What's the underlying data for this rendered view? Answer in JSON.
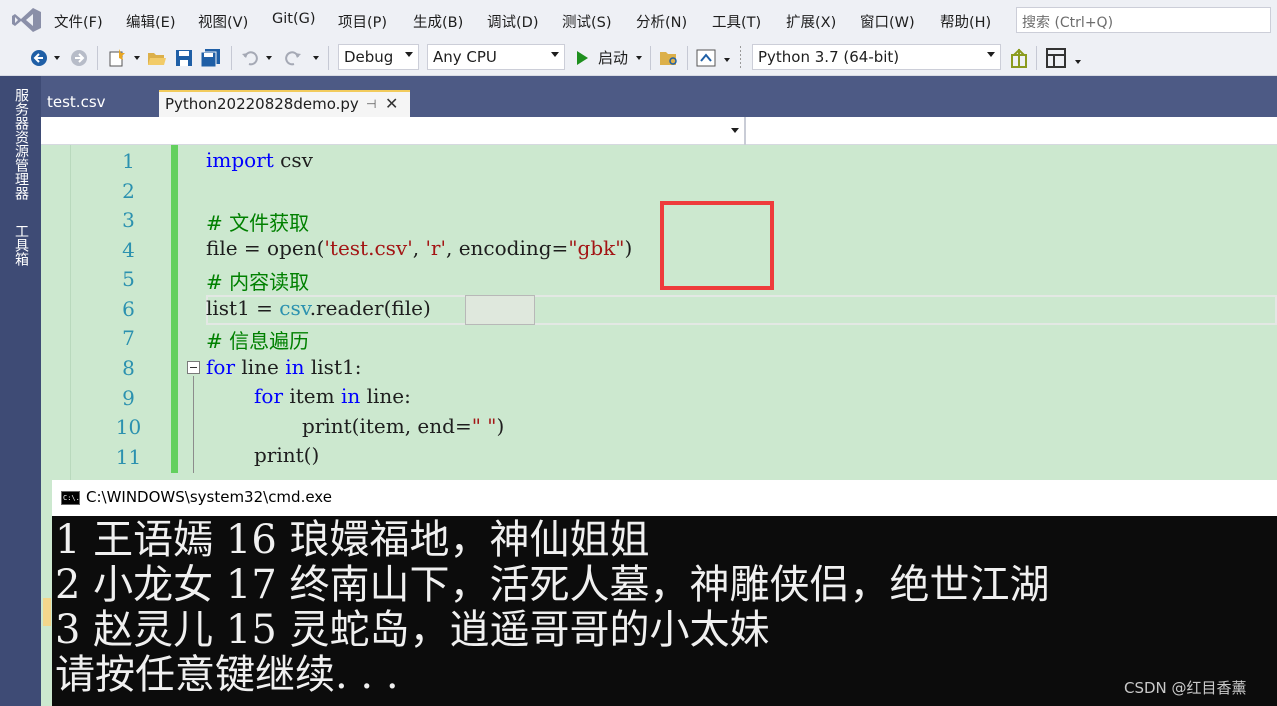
{
  "menu": {
    "items": [
      "文件(F)",
      "编辑(E)",
      "视图(V)",
      "Git(G)",
      "项目(P)",
      "生成(B)",
      "调试(D)",
      "测试(S)",
      "分析(N)",
      "工具(T)",
      "扩展(X)",
      "窗口(W)",
      "帮助(H)"
    ],
    "search_placeholder": "搜索 (Ctrl+Q)"
  },
  "toolbar": {
    "config": "Debug",
    "platform": "Any CPU",
    "start_label": "启动",
    "environment": "Python 3.7 (64-bit)"
  },
  "side_panels": [
    "服务器资源管理器",
    "工具箱"
  ],
  "tabs": [
    {
      "label": "test.csv"
    },
    {
      "label": "Python20220828demo.py"
    }
  ],
  "editor": {
    "line_numbers": [
      "1",
      "2",
      "3",
      "4",
      "5",
      "6",
      "7",
      "8",
      "9",
      "10",
      "11"
    ],
    "code": {
      "l1_kw": "import",
      "l1_rest": " csv",
      "l3": "# 文件获取",
      "l4_a": "file = open(",
      "l4_s1": "'test.csv'",
      "l4_b": ", ",
      "l4_s2": "'r'",
      "l4_c": ", encoding=",
      "l4_s3": "\"gbk\"",
      "l4_d": ")",
      "l5": "# 内容读取",
      "l6_a": "list1 = ",
      "l6_cls": "csv",
      "l6_b": ".reader(file)",
      "l7": "# 信息遍历",
      "l8_kw1": "for",
      "l8_a": " line ",
      "l8_kw2": "in",
      "l8_b": " list1:",
      "l9_kw1": "for",
      "l9_a": " item ",
      "l9_kw2": "in",
      "l9_b": " line:",
      "l10_a": "print(item, end=",
      "l10_s": "\" \"",
      "l10_b": ")",
      "l11": "print()"
    }
  },
  "console": {
    "title": "C:\\WINDOWS\\system32\\cmd.exe",
    "icon_text": "C:\\.",
    "lines": [
      "1 王语嫣 16 琅嬛福地，神仙姐姐",
      "2 小龙女 17 终南山下，活死人墓，神雕侠侣，绝世江湖",
      "3 赵灵儿 15 灵蛇岛，逍遥哥哥的小太妹",
      "请按任意键继续. . ."
    ]
  },
  "watermark": "CSDN @红目香薰",
  "colors": {
    "editor_bg": "#cce8cf",
    "keyword": "#0000ff",
    "string": "#a31515",
    "comment": "#008000",
    "highlight_box": "#ee3b3b",
    "change_bar": "#63d05e"
  }
}
